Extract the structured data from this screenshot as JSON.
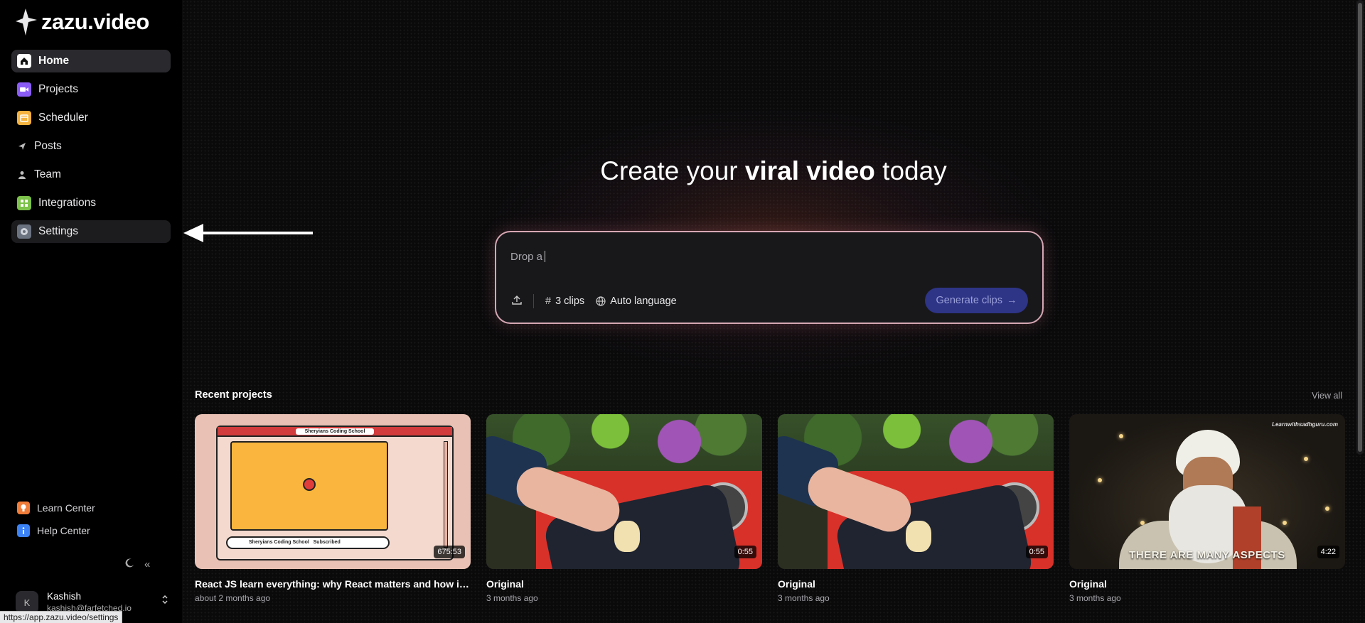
{
  "app": {
    "brand": "zazu.video",
    "status_url": "https://app.zazu.video/settings"
  },
  "sidebar": {
    "items": [
      {
        "label": "Home",
        "icon": "home-icon",
        "color": "#ffffff",
        "active": true
      },
      {
        "label": "Projects",
        "icon": "video-camera-icon",
        "color": "#8b5cf6"
      },
      {
        "label": "Scheduler",
        "icon": "calendar-icon",
        "color": "#f4b23e"
      },
      {
        "label": "Posts",
        "icon": "paper-plane-icon",
        "color": "#bbbbbb"
      },
      {
        "label": "Team",
        "icon": "user-icon",
        "color": "#bbbbbb"
      },
      {
        "label": "Integrations",
        "icon": "puzzle-icon",
        "color": "#7dc24b"
      },
      {
        "label": "Settings",
        "icon": "gear-icon",
        "color": "#9ca3af",
        "hovered": true
      }
    ],
    "bottom_links": [
      {
        "label": "Learn Center",
        "icon": "lightbulb-icon",
        "color": "#f07d3a"
      },
      {
        "label": "Help Center",
        "icon": "info-icon",
        "color": "#3b82f6"
      }
    ],
    "theme_icon": "moon-icon",
    "collapse_icon": "«",
    "user": {
      "initial": "K",
      "name": "Kashish",
      "email": "kashish@farfetched.io"
    }
  },
  "hero": {
    "headline_pre": "Create your ",
    "headline_bold": "viral video",
    "headline_post": " today"
  },
  "prompt": {
    "input_text": "Drop a",
    "clips": "3 clips",
    "language": "Auto language",
    "generate": "Generate clips",
    "accent": "#2e3486"
  },
  "recent": {
    "title": "Recent projects",
    "view_all": "View all",
    "projects": [
      {
        "title": "React JS learn everything: why React matters and how it w...",
        "time": "about 2 months ago",
        "duration": "675:53",
        "thumb_text_1": "Sheryians Coding School",
        "thumb_text_2": "Sheryians Coding School",
        "thumb_text_3": "Subscribed"
      },
      {
        "title": "Original",
        "time": "3 months ago",
        "duration": "0:55"
      },
      {
        "title": "Original",
        "time": "3 months ago",
        "duration": "0:55"
      },
      {
        "title": "Original",
        "time": "3 months ago",
        "duration": "4:22",
        "caption": "THERE ARE MANY ASPECTS",
        "watermark": "Learnwithsadhguru.com"
      }
    ]
  }
}
